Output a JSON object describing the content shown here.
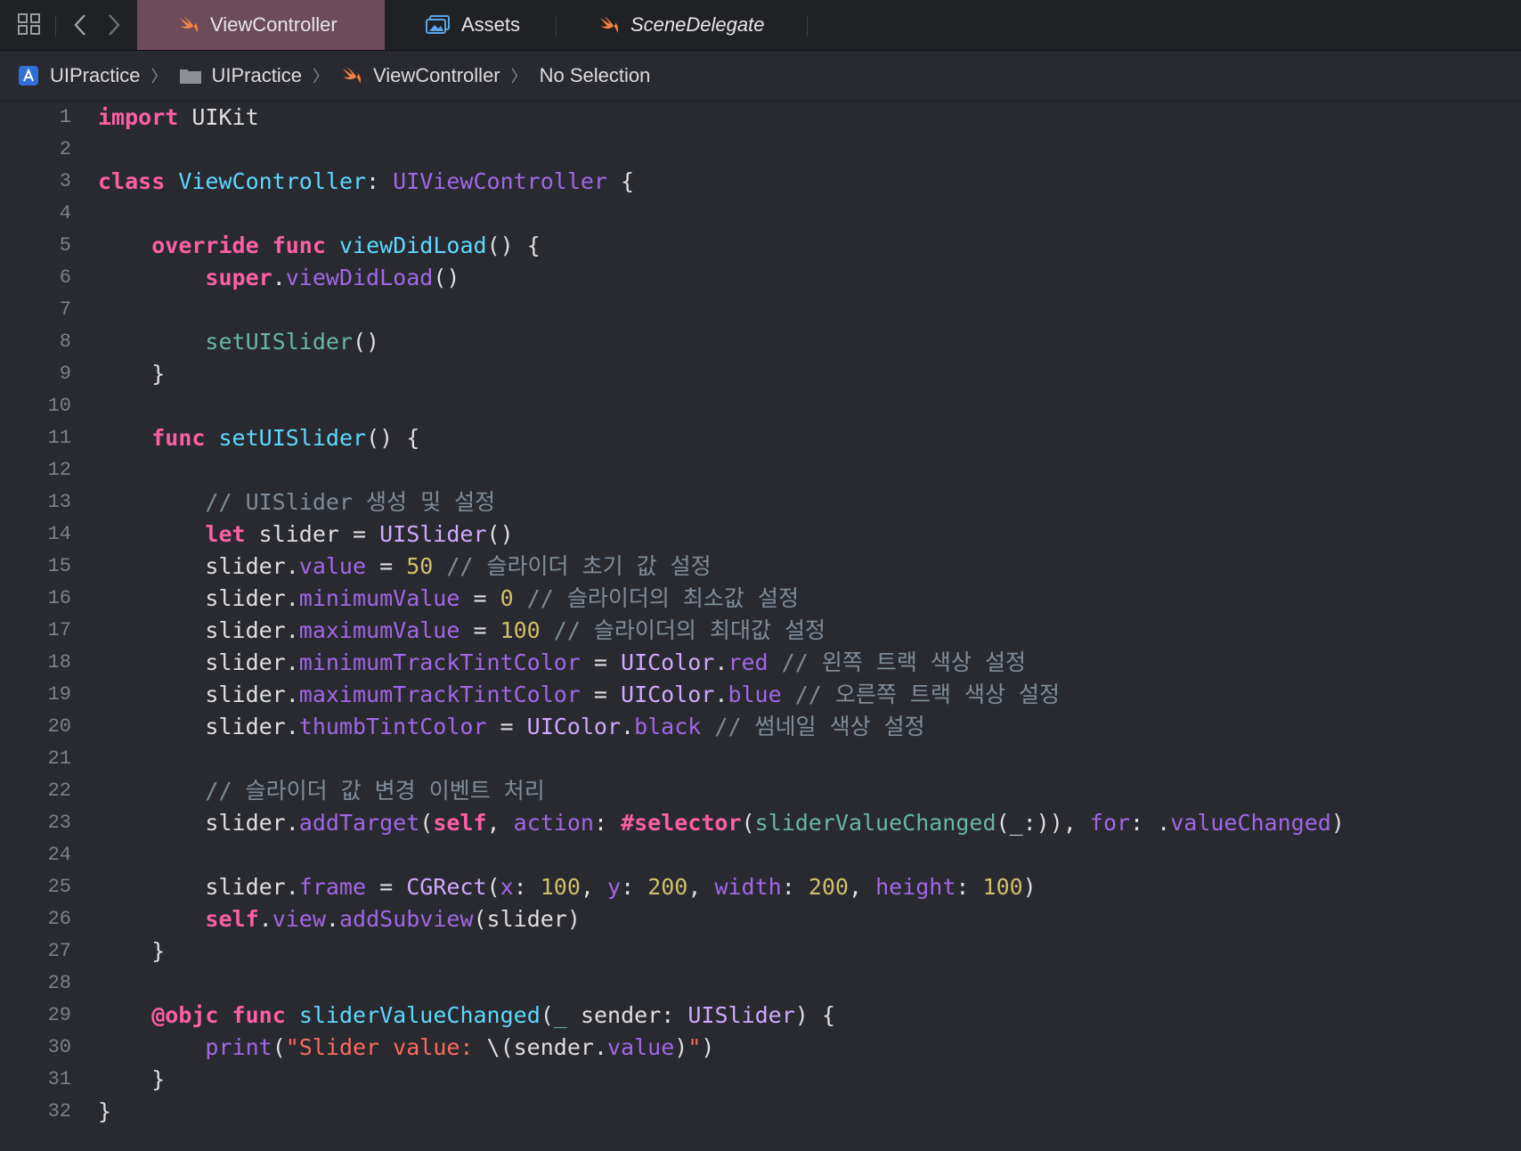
{
  "tabbar": {
    "tabs": [
      {
        "label": "ViewController",
        "icon": "swift-icon",
        "active": true
      },
      {
        "label": "Assets",
        "icon": "asset-catalog-icon",
        "active": false
      },
      {
        "label": "SceneDelegate",
        "icon": "swift-icon",
        "active": false
      }
    ]
  },
  "jumpbar": {
    "project": "UIPractice",
    "folder": "UIPractice",
    "file": "ViewController",
    "selection": "No Selection"
  },
  "editor": {
    "line_numbers": [
      "1",
      "2",
      "3",
      "4",
      "5",
      "6",
      "7",
      "8",
      "9",
      "10",
      "11",
      "12",
      "13",
      "14",
      "15",
      "16",
      "17",
      "18",
      "19",
      "20",
      "21",
      "22",
      "23",
      "24",
      "25",
      "26",
      "27",
      "28",
      "29",
      "30",
      "31",
      "32"
    ],
    "lines": [
      [
        [
          "kw",
          "import"
        ],
        [
          "pl",
          " UIKit"
        ]
      ],
      [],
      [
        [
          "kw",
          "class"
        ],
        [
          "pl",
          " "
        ],
        [
          "ty",
          "ViewController"
        ],
        [
          "pl",
          ": "
        ],
        [
          "pr",
          "UIViewController"
        ],
        [
          "pl",
          " {"
        ]
      ],
      [],
      [
        [
          "pl",
          "    "
        ],
        [
          "kw",
          "override"
        ],
        [
          "pl",
          " "
        ],
        [
          "kw",
          "func"
        ],
        [
          "pl",
          " "
        ],
        [
          "ty",
          "viewDidLoad"
        ],
        [
          "pl",
          "() {"
        ]
      ],
      [
        [
          "pl",
          "        "
        ],
        [
          "kw",
          "super"
        ],
        [
          "pl",
          "."
        ],
        [
          "pr",
          "viewDidLoad"
        ],
        [
          "pl",
          "()"
        ]
      ],
      [],
      [
        [
          "pl",
          "        "
        ],
        [
          "mp",
          "setUISlider"
        ],
        [
          "pl",
          "()"
        ]
      ],
      [
        [
          "pl",
          "    }"
        ]
      ],
      [],
      [
        [
          "pl",
          "    "
        ],
        [
          "kw",
          "func"
        ],
        [
          "pl",
          " "
        ],
        [
          "ty",
          "setUISlider"
        ],
        [
          "pl",
          "() {"
        ]
      ],
      [],
      [
        [
          "pl",
          "        "
        ],
        [
          "cm",
          "// UISlider 생성 및 설정"
        ]
      ],
      [
        [
          "pl",
          "        "
        ],
        [
          "kw",
          "let"
        ],
        [
          "pl",
          " slider = "
        ],
        [
          "sf",
          "UISlider"
        ],
        [
          "pl",
          "()"
        ]
      ],
      [
        [
          "pl",
          "        slider."
        ],
        [
          "pr",
          "value"
        ],
        [
          "pl",
          " = "
        ],
        [
          "nm",
          "50"
        ],
        [
          "pl",
          " "
        ],
        [
          "cm",
          "// 슬라이더 초기 값 설정"
        ]
      ],
      [
        [
          "pl",
          "        slider."
        ],
        [
          "pr",
          "minimumValue"
        ],
        [
          "pl",
          " = "
        ],
        [
          "nm",
          "0"
        ],
        [
          "pl",
          " "
        ],
        [
          "cm",
          "// 슬라이더의 최소값 설정"
        ]
      ],
      [
        [
          "pl",
          "        slider."
        ],
        [
          "pr",
          "maximumValue"
        ],
        [
          "pl",
          " = "
        ],
        [
          "nm",
          "100"
        ],
        [
          "pl",
          " "
        ],
        [
          "cm",
          "// 슬라이더의 최대값 설정"
        ]
      ],
      [
        [
          "pl",
          "        slider."
        ],
        [
          "pr",
          "minimumTrackTintColor"
        ],
        [
          "pl",
          " = "
        ],
        [
          "sf",
          "UIColor"
        ],
        [
          "pl",
          "."
        ],
        [
          "pr",
          "red"
        ],
        [
          "pl",
          " "
        ],
        [
          "cm",
          "// 왼쪽 트랙 색상 설정"
        ]
      ],
      [
        [
          "pl",
          "        slider."
        ],
        [
          "pr",
          "maximumTrackTintColor"
        ],
        [
          "pl",
          " = "
        ],
        [
          "sf",
          "UIColor"
        ],
        [
          "pl",
          "."
        ],
        [
          "pr",
          "blue"
        ],
        [
          "pl",
          " "
        ],
        [
          "cm",
          "// 오른쪽 트랙 색상 설정"
        ]
      ],
      [
        [
          "pl",
          "        slider."
        ],
        [
          "pr",
          "thumbTintColor"
        ],
        [
          "pl",
          " = "
        ],
        [
          "sf",
          "UIColor"
        ],
        [
          "pl",
          "."
        ],
        [
          "pr",
          "black"
        ],
        [
          "pl",
          " "
        ],
        [
          "cm",
          "// 썸네일 색상 설정"
        ]
      ],
      [],
      [
        [
          "pl",
          "        "
        ],
        [
          "cm",
          "// 슬라이더 값 변경 이벤트 처리"
        ]
      ],
      [
        [
          "pl",
          "        slider."
        ],
        [
          "pr",
          "addTarget"
        ],
        [
          "pl",
          "("
        ],
        [
          "kw",
          "self"
        ],
        [
          "pl",
          ", "
        ],
        [
          "pr",
          "action"
        ],
        [
          "pl",
          ": "
        ],
        [
          "kw",
          "#selector"
        ],
        [
          "pl",
          "("
        ],
        [
          "mp",
          "sliderValueChanged"
        ],
        [
          "pl",
          "(_:)), "
        ],
        [
          "pr",
          "for"
        ],
        [
          "pl",
          ": ."
        ],
        [
          "pr",
          "valueChanged"
        ],
        [
          "pl",
          ")"
        ]
      ],
      [],
      [
        [
          "pl",
          "        slider."
        ],
        [
          "pr",
          "frame"
        ],
        [
          "pl",
          " = "
        ],
        [
          "sf",
          "CGRect"
        ],
        [
          "pl",
          "("
        ],
        [
          "pr",
          "x"
        ],
        [
          "pl",
          ": "
        ],
        [
          "nm",
          "100"
        ],
        [
          "pl",
          ", "
        ],
        [
          "pr",
          "y"
        ],
        [
          "pl",
          ": "
        ],
        [
          "nm",
          "200"
        ],
        [
          "pl",
          ", "
        ],
        [
          "pr",
          "width"
        ],
        [
          "pl",
          ": "
        ],
        [
          "nm",
          "200"
        ],
        [
          "pl",
          ", "
        ],
        [
          "pr",
          "height"
        ],
        [
          "pl",
          ": "
        ],
        [
          "nm",
          "100"
        ],
        [
          "pl",
          ")"
        ]
      ],
      [
        [
          "pl",
          "        "
        ],
        [
          "kw",
          "self"
        ],
        [
          "pl",
          "."
        ],
        [
          "pr",
          "view"
        ],
        [
          "pl",
          "."
        ],
        [
          "pr",
          "addSubview"
        ],
        [
          "pl",
          "(slider)"
        ]
      ],
      [
        [
          "pl",
          "    }"
        ]
      ],
      [],
      [
        [
          "pl",
          "    "
        ],
        [
          "kw",
          "@objc"
        ],
        [
          "pl",
          " "
        ],
        [
          "kw",
          "func"
        ],
        [
          "pl",
          " "
        ],
        [
          "ty",
          "sliderValueChanged"
        ],
        [
          "pl",
          "("
        ],
        [
          "mp",
          "_"
        ],
        [
          "pl",
          " sender: "
        ],
        [
          "sf",
          "UISlider"
        ],
        [
          "pl",
          ") {"
        ]
      ],
      [
        [
          "pl",
          "        "
        ],
        [
          "pr",
          "print"
        ],
        [
          "pl",
          "("
        ],
        [
          "st",
          "\"Slider value: "
        ],
        [
          "pl",
          "\\(sender."
        ],
        [
          "pr",
          "value"
        ],
        [
          "pl",
          ")"
        ],
        [
          "st",
          "\""
        ],
        [
          "pl",
          ")"
        ]
      ],
      [
        [
          "pl",
          "    }"
        ]
      ],
      [
        [
          "pl",
          "}"
        ]
      ]
    ]
  }
}
